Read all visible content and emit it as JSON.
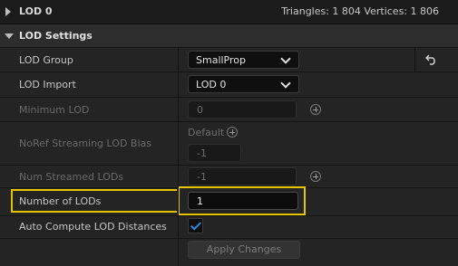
{
  "lod0": {
    "title": "LOD 0",
    "stats": "Triangles: 1 804   Vertices: 1 806"
  },
  "section": {
    "title": "LOD Settings"
  },
  "rows": {
    "lod_group": {
      "label": "LOD Group",
      "value": "SmallProp"
    },
    "lod_import": {
      "label": "LOD Import",
      "value": "LOD 0"
    },
    "minimum_lod": {
      "label": "Minimum LOD",
      "value": "0"
    },
    "noref": {
      "label": "NoRef Streaming LOD Bias",
      "default_label": "Default",
      "value": "-1"
    },
    "num_streamed": {
      "label": "Num Streamed LODs",
      "value": "-1"
    },
    "number_of_lods": {
      "label": "Number of LODs",
      "value": "1"
    },
    "auto_compute": {
      "label": "Auto Compute LOD Distances",
      "checked": true
    },
    "apply": {
      "label": "Apply Changes"
    }
  },
  "colors": {
    "highlight": "#e5c400",
    "check": "#2e8be0"
  },
  "icons": {
    "reset": "reset-arrow-icon",
    "add": "plus-circle-icon"
  }
}
